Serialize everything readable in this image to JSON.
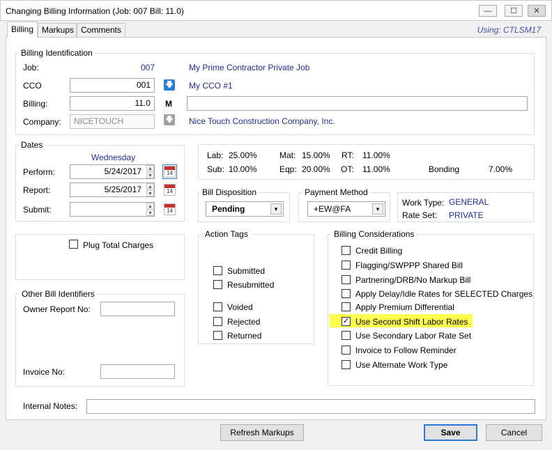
{
  "window": {
    "title": "Changing Billing Information  (Job: 007  Bill:   11.0)",
    "using": "Using: CTLSM17"
  },
  "tabs": [
    "Billing",
    "Markups",
    "Comments"
  ],
  "billing_identification": {
    "legend": "Billing Identification",
    "job_label": "Job:",
    "job_value": "007",
    "job_desc": "My Prime Contractor Private Job",
    "cco_label": "CCO",
    "cco_value": "001",
    "cco_desc": "My CCO #1",
    "billing_label": "Billing:",
    "billing_value": "11.0",
    "billing_flag": "M",
    "billing_desc": "",
    "company_label": "Company:",
    "company_value": "NICETOUCH",
    "company_desc": "Nice Touch Construction Company, Inc."
  },
  "dates": {
    "legend": "Dates",
    "weekday": "Wednesday",
    "perform_label": "Perform:",
    "perform_value": "5/24/2017",
    "report_label": "Report:",
    "report_value": "5/25/2017",
    "submit_label": "Submit:",
    "submit_value": "",
    "cal_day": "14"
  },
  "rates": {
    "lab_label": "Lab:",
    "lab_value": "25.00%",
    "mat_label": "Mat:",
    "mat_value": "15.00%",
    "rt_label": "RT:",
    "rt_value": "11.00%",
    "sub_label": "Sub:",
    "sub_value": "10.00%",
    "eqp_label": "Eqp:",
    "eqp_value": "20.00%",
    "ot_label": "OT:",
    "ot_value": "11.00%",
    "bonding_label": "Bonding",
    "bonding_value": "7.00%"
  },
  "bill_disposition": {
    "legend": "Bill Disposition",
    "value": "Pending"
  },
  "payment_method": {
    "legend": "Payment Method",
    "value": "+EW@FA"
  },
  "work_info": {
    "work_type_label": "Work Type:",
    "work_type_value": "GENERAL",
    "rate_set_label": "Rate Set:",
    "rate_set_value": "PRIVATE"
  },
  "plug_total": {
    "label": "Plug Total Charges",
    "checked": false
  },
  "action_tags": {
    "legend": "Action Tags",
    "items": [
      "Submitted",
      "Resubmitted",
      "Voided",
      "Rejected",
      "Returned"
    ]
  },
  "billing_considerations": {
    "legend": "Billing Considerations",
    "items": [
      "Credit Billing",
      "Flagging/SWPPP Shared Bill",
      "Partnering/DRB/No Markup Bill",
      "Apply Delay/Idle Rates for SELECTED Charges",
      "Apply Premium Differential",
      "Use Second Shift Labor Rates",
      "Use Secondary Labor Rate Set",
      "Invoice to Follow Reminder",
      "Use Alternate Work Type"
    ],
    "checked_mark": "✓"
  },
  "other_identifiers": {
    "legend": "Other Bill Identifiers",
    "owner_label": "Owner Report No:",
    "owner_value": "",
    "invoice_label": "Invoice No:",
    "invoice_value": ""
  },
  "internal_notes": {
    "label": "Internal Notes:",
    "value": ""
  },
  "buttons": {
    "refresh": "Refresh Markups",
    "save": "Save",
    "cancel": "Cancel"
  },
  "icons": {
    "minimize": "—",
    "maximize": "☐",
    "close": "✕",
    "dropdown": "▾",
    "lookup": "🡇",
    "spin_up": "▲",
    "spin_down": "▼"
  },
  "colors": {
    "link_blue": "#1f2e8f",
    "highlight": "#ffff50",
    "lookup_active": "#2a7fd4",
    "lookup_disabled": "#a0a0a0"
  }
}
